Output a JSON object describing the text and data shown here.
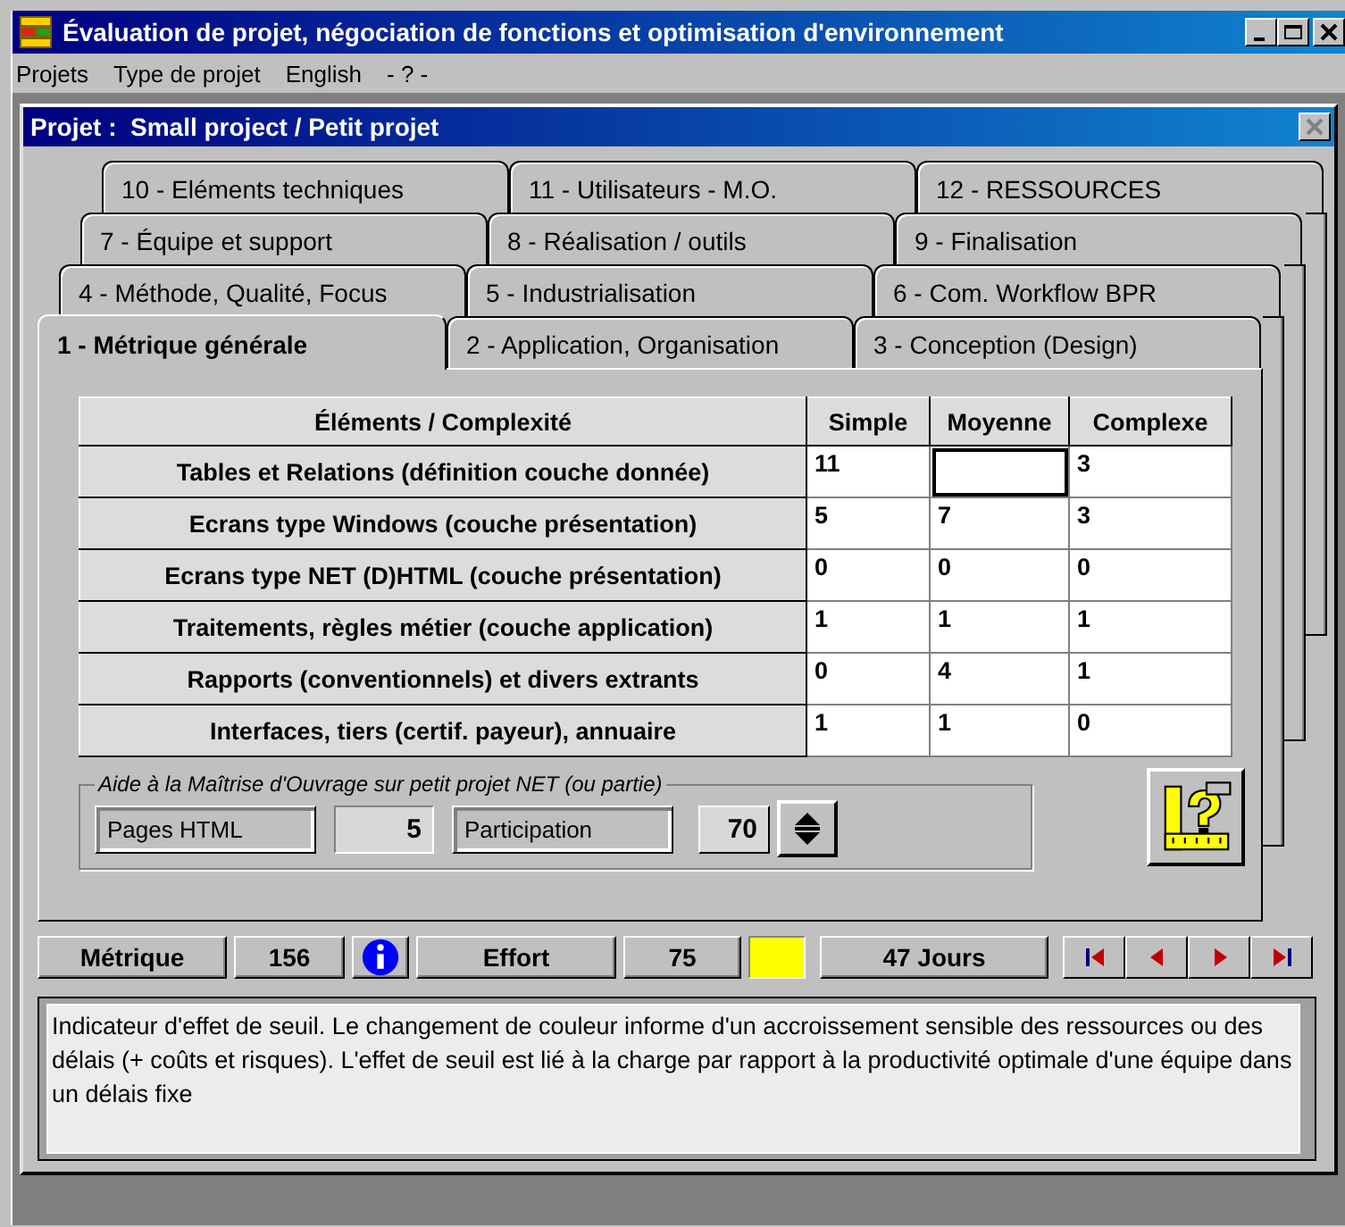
{
  "window": {
    "title": "Évaluation de projet, négociation de fonctions et optimisation d'environnement"
  },
  "menu": [
    "Projets",
    "Type de projet",
    "English",
    "- ? -"
  ],
  "child_window": {
    "title": "Projet :  Small project / Petit projet"
  },
  "tabs": [
    {
      "label": "10 - Eléments techniques",
      "selected": false
    },
    {
      "label": "11 - Utilisateurs - M.O.",
      "selected": false
    },
    {
      "label": "12 - RESSOURCES",
      "selected": false
    },
    {
      "label": "7 - Équipe et support",
      "selected": false
    },
    {
      "label": "8 - Réalisation / outils",
      "selected": false
    },
    {
      "label": "9 - Finalisation",
      "selected": false
    },
    {
      "label": "4 - Méthode, Qualité, Focus",
      "selected": false
    },
    {
      "label": "5 - Industrialisation",
      "selected": false
    },
    {
      "label": "6 - Com. Workflow BPR",
      "selected": false
    },
    {
      "label": "1 - Métrique générale",
      "selected": true
    },
    {
      "label": "2 - Application, Organisation",
      "selected": false
    },
    {
      "label": "3 - Conception (Design)",
      "selected": false
    }
  ],
  "table": {
    "columns": [
      "Éléments / Complexité",
      "Simple",
      "Moyenne",
      "Complexe"
    ],
    "rows": [
      {
        "cells": [
          {
            "value": "Tables et Relations (définition couche donnée)",
            "focused": false
          },
          {
            "value": "11",
            "focused": false
          },
          {
            "focused": true
          },
          {
            "value": "3",
            "focused": false
          }
        ]
      },
      {
        "cells": [
          {
            "value": "Ecrans type Windows (couche présentation)",
            "focused": false
          },
          {
            "value": "5",
            "focused": false
          },
          {
            "value": "7",
            "focused": false
          },
          {
            "value": "3",
            "focused": false
          }
        ]
      },
      {
        "cells": [
          {
            "value": "Ecrans type NET (D)HTML (couche présentation)",
            "focused": false
          },
          {
            "value": "0",
            "focused": false
          },
          {
            "value": "0",
            "focused": false
          },
          {
            "value": "0",
            "focused": false
          }
        ]
      },
      {
        "cells": [
          {
            "value": "Traitements, règles métier (couche application)",
            "focused": false
          },
          {
            "value": "1",
            "focused": false
          },
          {
            "value": "1",
            "focused": false
          },
          {
            "value": "1",
            "focused": false
          }
        ]
      },
      {
        "cells": [
          {
            "value": "Rapports (conventionnels) et divers extrants",
            "focused": false
          },
          {
            "value": "0",
            "focused": false
          },
          {
            "value": "4",
            "focused": false
          },
          {
            "value": "1",
            "focused": false
          }
        ]
      },
      {
        "cells": [
          {
            "value": "Interfaces, tiers (certif. payeur), annuaire",
            "focused": false
          },
          {
            "value": "1",
            "focused": false
          },
          {
            "value": "1",
            "focused": false
          },
          {
            "value": "0",
            "focused": false
          }
        ]
      }
    ]
  },
  "group": {
    "legend": "Aide à la Maîtrise d'Ouvrage sur petit projet NET (ou partie)",
    "fields": [
      {
        "kind": "plain",
        "label": "Pages HTML",
        "value": "5"
      },
      {
        "kind": "spinner",
        "label": "Participation",
        "value": "70"
      }
    ]
  },
  "status_bar": [
    {
      "kind": "label",
      "text": "Métrique"
    },
    {
      "kind": "value",
      "text": "156"
    },
    {
      "kind": "info"
    },
    {
      "kind": "label",
      "text": "Effort"
    },
    {
      "kind": "value",
      "text": "75"
    },
    {
      "kind": "swatch",
      "color": "#ffff00"
    },
    {
      "kind": "label",
      "text": "47 Jours"
    }
  ],
  "description": "Indicateur d'effet de seuil. Le changement de couleur informe d'un accroissement sensible des ressources ou des délais (+ coûts et risques). L'effet de seuil est lié à la charge par rapport à la productivité optimale d'une équipe dans un délais fixe"
}
